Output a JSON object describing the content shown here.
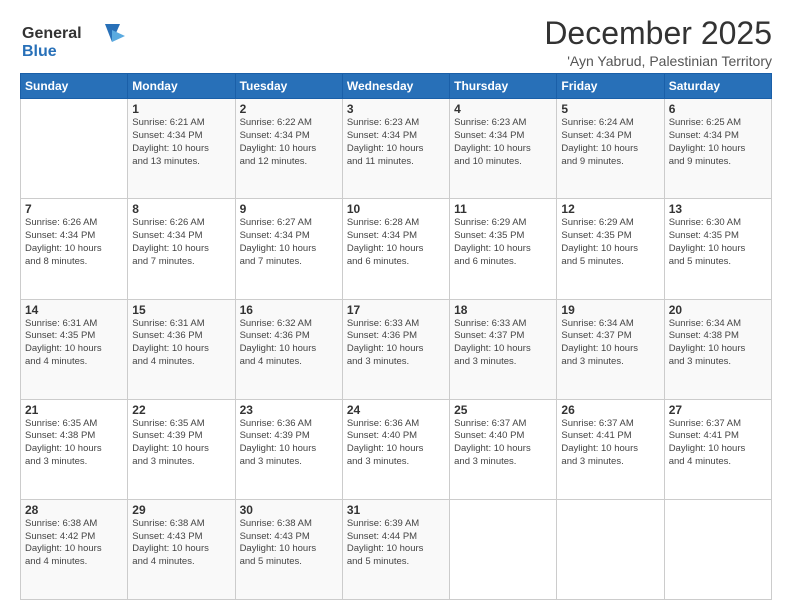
{
  "logo": {
    "line1": "General",
    "line2": "Blue"
  },
  "title": "December 2025",
  "subtitle": "'Ayn Yabrud, Palestinian Territory",
  "days_header": [
    "Sunday",
    "Monday",
    "Tuesday",
    "Wednesday",
    "Thursday",
    "Friday",
    "Saturday"
  ],
  "weeks": [
    [
      {
        "day": "",
        "info": ""
      },
      {
        "day": "1",
        "info": "Sunrise: 6:21 AM\nSunset: 4:34 PM\nDaylight: 10 hours\nand 13 minutes."
      },
      {
        "day": "2",
        "info": "Sunrise: 6:22 AM\nSunset: 4:34 PM\nDaylight: 10 hours\nand 12 minutes."
      },
      {
        "day": "3",
        "info": "Sunrise: 6:23 AM\nSunset: 4:34 PM\nDaylight: 10 hours\nand 11 minutes."
      },
      {
        "day": "4",
        "info": "Sunrise: 6:23 AM\nSunset: 4:34 PM\nDaylight: 10 hours\nand 10 minutes."
      },
      {
        "day": "5",
        "info": "Sunrise: 6:24 AM\nSunset: 4:34 PM\nDaylight: 10 hours\nand 9 minutes."
      },
      {
        "day": "6",
        "info": "Sunrise: 6:25 AM\nSunset: 4:34 PM\nDaylight: 10 hours\nand 9 minutes."
      }
    ],
    [
      {
        "day": "7",
        "info": "Sunrise: 6:26 AM\nSunset: 4:34 PM\nDaylight: 10 hours\nand 8 minutes."
      },
      {
        "day": "8",
        "info": "Sunrise: 6:26 AM\nSunset: 4:34 PM\nDaylight: 10 hours\nand 7 minutes."
      },
      {
        "day": "9",
        "info": "Sunrise: 6:27 AM\nSunset: 4:34 PM\nDaylight: 10 hours\nand 7 minutes."
      },
      {
        "day": "10",
        "info": "Sunrise: 6:28 AM\nSunset: 4:34 PM\nDaylight: 10 hours\nand 6 minutes."
      },
      {
        "day": "11",
        "info": "Sunrise: 6:29 AM\nSunset: 4:35 PM\nDaylight: 10 hours\nand 6 minutes."
      },
      {
        "day": "12",
        "info": "Sunrise: 6:29 AM\nSunset: 4:35 PM\nDaylight: 10 hours\nand 5 minutes."
      },
      {
        "day": "13",
        "info": "Sunrise: 6:30 AM\nSunset: 4:35 PM\nDaylight: 10 hours\nand 5 minutes."
      }
    ],
    [
      {
        "day": "14",
        "info": "Sunrise: 6:31 AM\nSunset: 4:35 PM\nDaylight: 10 hours\nand 4 minutes."
      },
      {
        "day": "15",
        "info": "Sunrise: 6:31 AM\nSunset: 4:36 PM\nDaylight: 10 hours\nand 4 minutes."
      },
      {
        "day": "16",
        "info": "Sunrise: 6:32 AM\nSunset: 4:36 PM\nDaylight: 10 hours\nand 4 minutes."
      },
      {
        "day": "17",
        "info": "Sunrise: 6:33 AM\nSunset: 4:36 PM\nDaylight: 10 hours\nand 3 minutes."
      },
      {
        "day": "18",
        "info": "Sunrise: 6:33 AM\nSunset: 4:37 PM\nDaylight: 10 hours\nand 3 minutes."
      },
      {
        "day": "19",
        "info": "Sunrise: 6:34 AM\nSunset: 4:37 PM\nDaylight: 10 hours\nand 3 minutes."
      },
      {
        "day": "20",
        "info": "Sunrise: 6:34 AM\nSunset: 4:38 PM\nDaylight: 10 hours\nand 3 minutes."
      }
    ],
    [
      {
        "day": "21",
        "info": "Sunrise: 6:35 AM\nSunset: 4:38 PM\nDaylight: 10 hours\nand 3 minutes."
      },
      {
        "day": "22",
        "info": "Sunrise: 6:35 AM\nSunset: 4:39 PM\nDaylight: 10 hours\nand 3 minutes."
      },
      {
        "day": "23",
        "info": "Sunrise: 6:36 AM\nSunset: 4:39 PM\nDaylight: 10 hours\nand 3 minutes."
      },
      {
        "day": "24",
        "info": "Sunrise: 6:36 AM\nSunset: 4:40 PM\nDaylight: 10 hours\nand 3 minutes."
      },
      {
        "day": "25",
        "info": "Sunrise: 6:37 AM\nSunset: 4:40 PM\nDaylight: 10 hours\nand 3 minutes."
      },
      {
        "day": "26",
        "info": "Sunrise: 6:37 AM\nSunset: 4:41 PM\nDaylight: 10 hours\nand 3 minutes."
      },
      {
        "day": "27",
        "info": "Sunrise: 6:37 AM\nSunset: 4:41 PM\nDaylight: 10 hours\nand 4 minutes."
      }
    ],
    [
      {
        "day": "28",
        "info": "Sunrise: 6:38 AM\nSunset: 4:42 PM\nDaylight: 10 hours\nand 4 minutes."
      },
      {
        "day": "29",
        "info": "Sunrise: 6:38 AM\nSunset: 4:43 PM\nDaylight: 10 hours\nand 4 minutes."
      },
      {
        "day": "30",
        "info": "Sunrise: 6:38 AM\nSunset: 4:43 PM\nDaylight: 10 hours\nand 5 minutes."
      },
      {
        "day": "31",
        "info": "Sunrise: 6:39 AM\nSunset: 4:44 PM\nDaylight: 10 hours\nand 5 minutes."
      },
      {
        "day": "",
        "info": ""
      },
      {
        "day": "",
        "info": ""
      },
      {
        "day": "",
        "info": ""
      }
    ]
  ]
}
